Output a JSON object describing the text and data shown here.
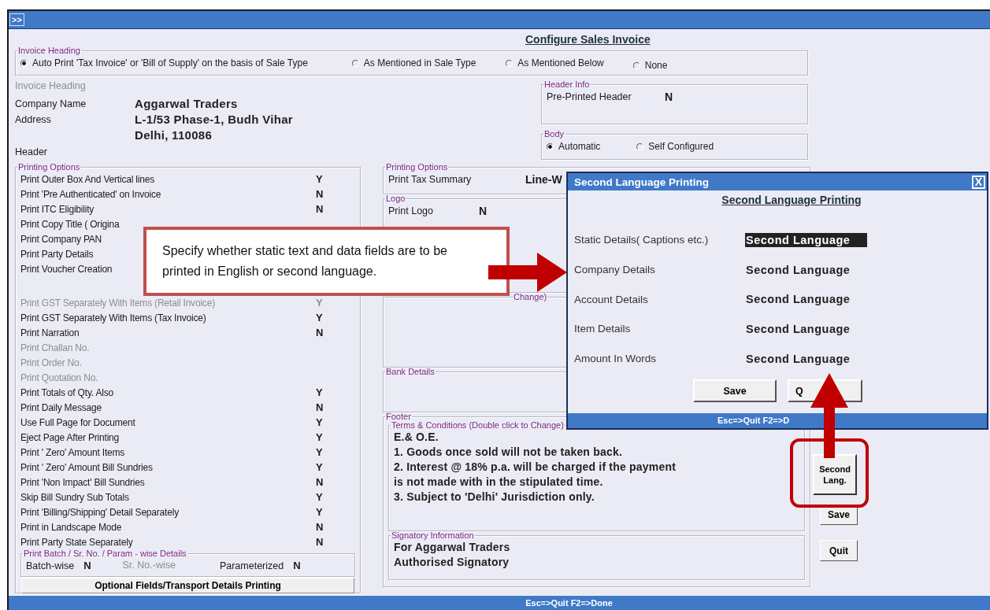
{
  "window": {
    "title_button": ">>"
  },
  "heading": "Configure Sales Invoice",
  "invoice_heading": {
    "legend": "Invoice Heading",
    "options": [
      {
        "label": "Auto Print 'Tax Invoice' or  'Bill of Supply' on the basis of Sale Type",
        "selected": true
      },
      {
        "label": "As Mentioned in Sale Type",
        "selected": false
      },
      {
        "label": "As Mentioned Below",
        "selected": false
      },
      {
        "label": "None",
        "selected": false
      }
    ]
  },
  "company": {
    "section_label": "Invoice Heading",
    "fields": [
      {
        "label": "Company Name",
        "lines": [
          "Aggarwal Traders"
        ]
      },
      {
        "label": "Address",
        "lines": [
          "L-1/53 Phase-1, Budh Vihar",
          "Delhi, 110086"
        ]
      }
    ],
    "header_label": "Header"
  },
  "header_info": {
    "legend": "Header Info",
    "label": "Pre-Printed Header",
    "value": "N"
  },
  "body": {
    "legend": "Body",
    "options": [
      {
        "label": "Automatic",
        "selected": true
      },
      {
        "label": "Self Configured",
        "selected": false
      }
    ]
  },
  "printing_options": {
    "legend": "Printing Options",
    "items": [
      {
        "label": "Print Outer Box And Vertical lines",
        "value": "Y",
        "disabled": false
      },
      {
        "label": "Print 'Pre Authenticated' on Invoice",
        "value": "N",
        "disabled": false
      },
      {
        "label": "Print ITC Eligibility",
        "value": "N",
        "disabled": false
      },
      {
        "label": "Print Copy Title ( Origina",
        "disabled": false
      },
      {
        "label": "Print Company PAN",
        "disabled": false
      },
      {
        "label": "Print Party Details",
        "disabled": false
      },
      {
        "label": "Print Voucher Creation",
        "disabled": false
      },
      {
        "label": "Print GST Separately With Items (Retail Invoice)",
        "value": "Y",
        "disabled": true
      },
      {
        "label": "Print GST Separately With Items (Tax Invoice)",
        "value": "Y",
        "disabled": false
      },
      {
        "label": "Print Narration",
        "value": "N",
        "disabled": false
      },
      {
        "label": "Print Challan No.",
        "disabled": true
      },
      {
        "label": "Print Order No.",
        "disabled": true
      },
      {
        "label": "Print Quotation No.",
        "disabled": true
      },
      {
        "label": "Print Totals of Qty. Also",
        "value": "Y",
        "disabled": false
      },
      {
        "label": "Print Daily Message",
        "value": "N",
        "disabled": false
      },
      {
        "label": "Use Full Page for Document",
        "value": "Y",
        "disabled": false
      },
      {
        "label": "Eject Page After Printing",
        "value": "Y",
        "disabled": false
      },
      {
        "label": "Print ' Zero' Amount Items",
        "value": "Y",
        "disabled": false
      },
      {
        "label": "Print ' Zero' Amount Bill Sundries",
        "value": "Y",
        "disabled": false
      },
      {
        "label": "Print 'Non Impact' Bill Sundries",
        "value": "N",
        "disabled": false
      },
      {
        "label": "Skip Bill Sundry Sub Totals",
        "value": "Y",
        "disabled": false
      },
      {
        "label": "Print 'Billing/Shipping' Detail Separately",
        "value": "Y",
        "disabled": false
      },
      {
        "label": "Print in Landscape Mode",
        "value": "N",
        "disabled": false
      },
      {
        "label": "Print Party State Separately",
        "value": "N",
        "disabled": false
      }
    ],
    "batch": {
      "legend": "Print Batch / Sr. No. / Param - wise Details",
      "items": [
        {
          "label": "Batch-wise",
          "value": "N",
          "disabled": false
        },
        {
          "label": "Sr. No.-wise",
          "disabled": true
        },
        {
          "label": "Parameterized",
          "value": "N",
          "disabled": false
        }
      ]
    },
    "button": "Optional Fields/Transport Details Printing"
  },
  "printing_options_2": {
    "legend": "Printing Options",
    "label": "Print Tax Summary",
    "value": "Line-W"
  },
  "logo": {
    "legend": "Logo",
    "label": "Print Logo",
    "value": "N"
  },
  "hidden_group": {
    "legend": "Change)"
  },
  "bank_details": {
    "legend": "Bank Details"
  },
  "footer": {
    "legend": "Footer",
    "terms": {
      "legend": "Terms & Conditions (Double click to Change)",
      "lines": [
        "E.& O.E.",
        "1. Goods once sold will not be taken back.",
        "2. Interest @ 18% p.a. will be charged if the payment",
        "is not made with in the stipulated time.",
        "3. Subject to 'Delhi' Jurisdiction only."
      ]
    },
    "signatory": {
      "legend": "Signatory Information",
      "lines": [
        "For Aggarwal Traders",
        "Authorised Signatory"
      ]
    }
  },
  "side_buttons": [
    "Second Lang.",
    "Save",
    "Quit"
  ],
  "status_bar": "Esc=>Quit  F2=>Done",
  "dialog": {
    "title": "Second Language Printing",
    "close": "X",
    "heading": "Second Language Printing",
    "rows": [
      {
        "label": "Static Details( Captions etc.)",
        "value": "Second Language",
        "selected": true
      },
      {
        "label": "Company Details",
        "value": "Second Language",
        "selected": false
      },
      {
        "label": "Account Details",
        "value": "Second Language",
        "selected": false
      },
      {
        "label": "Item Details",
        "value": "Second Language",
        "selected": false
      },
      {
        "label": "Amount In Words",
        "value": "Second Language",
        "selected": false
      }
    ],
    "buttons": [
      "Save",
      "Q"
    ],
    "status_bar": "Esc=>Quit   F2=>D"
  },
  "annotation": {
    "text": "Specify whether static text and data fields are to be printed in English or second language."
  }
}
